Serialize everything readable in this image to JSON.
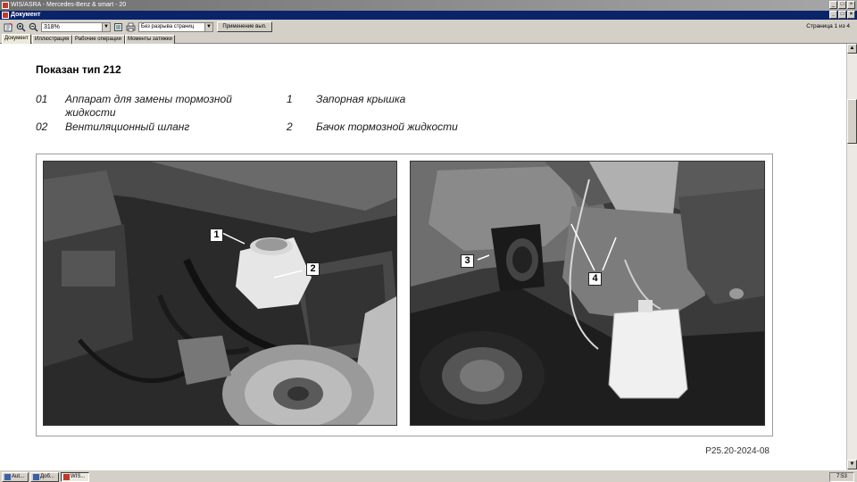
{
  "app": {
    "title": "WIS/ASRA - Mercedes-Benz & smart - 20",
    "window_controls": [
      "_",
      "□",
      "×"
    ]
  },
  "document_window": {
    "title": "Документ",
    "window_controls": [
      "_",
      "□",
      "×"
    ]
  },
  "toolbar": {
    "zoom_value": "318%",
    "page_mode_value": "Без разрыва страниц",
    "apply_label": "Применение вып.",
    "page_info": "Страница 1 из 4",
    "icons": [
      "open-icon",
      "zoom-in-icon",
      "zoom-out-icon",
      "page-icon",
      "print-icon"
    ]
  },
  "tabs": [
    {
      "label": "Документ",
      "active": true
    },
    {
      "label": "Иллюстрация",
      "active": false
    },
    {
      "label": "Рабочие операции",
      "active": false
    },
    {
      "label": "Моменты затяжки",
      "active": false
    }
  ],
  "document": {
    "heading": "Показан тип 212",
    "legend": [
      {
        "num": "01",
        "text": "Аппарат для замены тормозной жидкости"
      },
      {
        "num": "02",
        "text": "Вентиляционный шланг"
      },
      {
        "num": "1",
        "text": "Запорная крышка"
      },
      {
        "num": "2",
        "text": "Бачок тормозной жидкости"
      }
    ],
    "callouts_left": [
      "1",
      "2"
    ],
    "callouts_right": [
      "3",
      "4"
    ],
    "figure_ref": "P25.20-2024-08"
  },
  "taskbar": {
    "items": [
      {
        "label": "Aut...",
        "active": false
      },
      {
        "label": "Доб...",
        "active": false
      },
      {
        "label": "WIS...",
        "active": true
      }
    ],
    "clock": "7:53"
  }
}
